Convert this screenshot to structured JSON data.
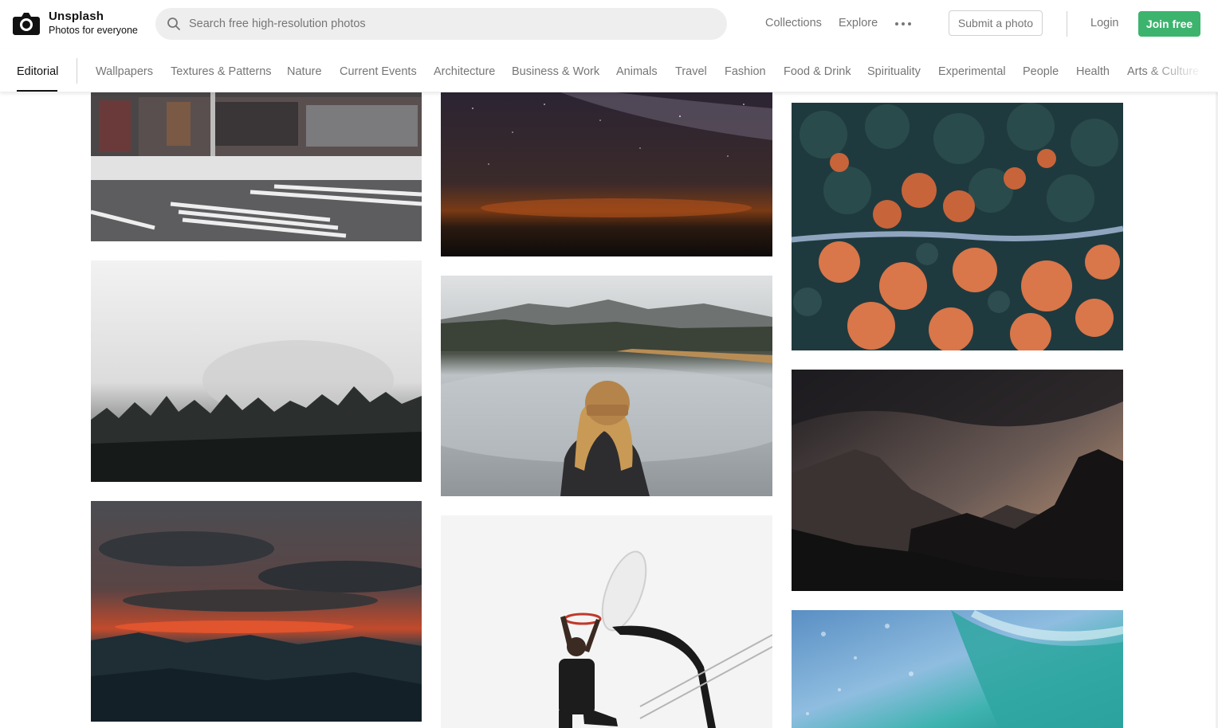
{
  "header": {
    "brand_name": "Unsplash",
    "brand_tagline": "Photos for everyone",
    "search_placeholder": "Search free high-resolution photos",
    "nav": {
      "collections": "Collections",
      "explore": "Explore"
    },
    "submit_label": "Submit a photo",
    "login_label": "Login",
    "join_label": "Join free",
    "accent_color": "#3cb46e"
  },
  "categories": {
    "active": "Editorial",
    "items": [
      "Wallpapers",
      "Textures & Patterns",
      "Nature",
      "Current Events",
      "Architecture",
      "Business & Work",
      "Animals",
      "Travel",
      "Fashion",
      "Food & Drink",
      "Spirituality",
      "Experimental",
      "People",
      "Health",
      "Arts & Culture"
    ]
  },
  "photos": [
    {
      "name": "snowy-street-corner-photo",
      "subject": "snowy street corner"
    },
    {
      "name": "misty-forest-photo",
      "subject": "misty pine forest"
    },
    {
      "name": "red-sunset-mountains-photo",
      "subject": "red sunset over mountains"
    },
    {
      "name": "milky-way-night-sky-photo",
      "subject": "milky way over horizon"
    },
    {
      "name": "woman-lake-mountains-photo",
      "subject": "woman in beanie at lake"
    },
    {
      "name": "basketball-dunk-photo",
      "subject": "basketball dunk"
    },
    {
      "name": "autumn-forest-road-aerial-photo",
      "subject": "aerial autumn forest road"
    },
    {
      "name": "dark-mountain-silhouette-photo",
      "subject": "dark mountain silhouettes"
    },
    {
      "name": "ocean-wave-photo",
      "subject": "turquoise ocean wave"
    }
  ]
}
